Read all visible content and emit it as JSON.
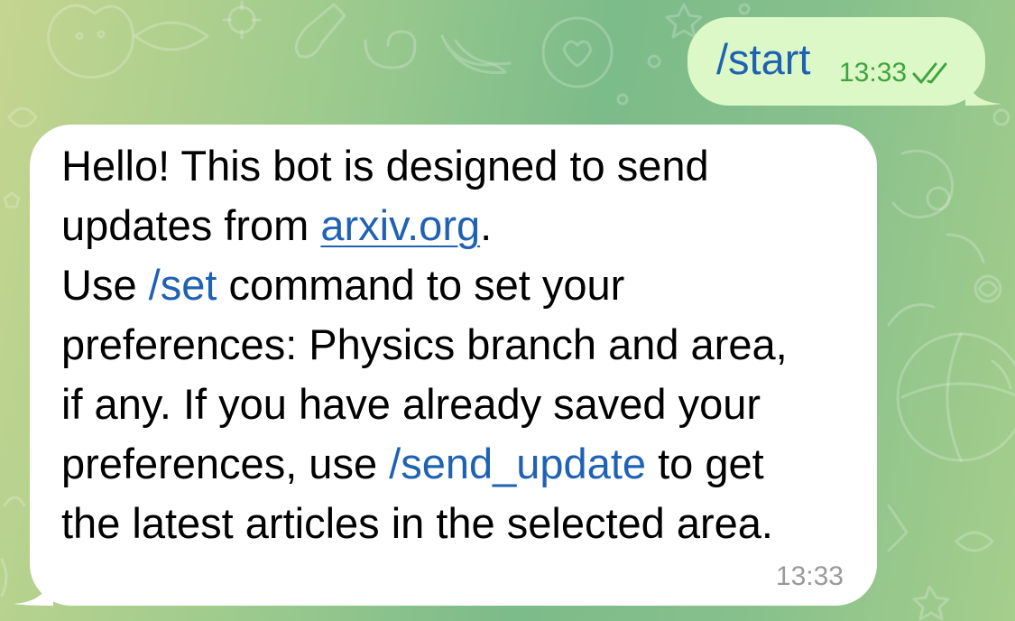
{
  "colors": {
    "outgoing_bubble": "#dcf8c6",
    "incoming_bubble": "#ffffff",
    "link": "#1f62b3",
    "outgoing_time": "#3fa33f",
    "incoming_time": "#9a9a9a"
  },
  "outgoing_message": {
    "text": "/start",
    "time": "13:33",
    "status_icon": "double-check-icon"
  },
  "incoming_message": {
    "line1": "Hello! This bot is designed to send",
    "line2_prefix": "updates from ",
    "link_arxiv": "arxiv.org",
    "line2_suffix": ".",
    "line3_prefix": "Use ",
    "cmd_set": "/set",
    "line3_suffix": " command to set your",
    "line4": "preferences: Physics branch and area,",
    "line5": "if any. If you have already saved your",
    "line6_prefix": "preferences, use ",
    "cmd_send_update": "/send_update",
    "line6_suffix": " to get",
    "line7": "the latest articles in the selected area.",
    "time": "13:33"
  }
}
